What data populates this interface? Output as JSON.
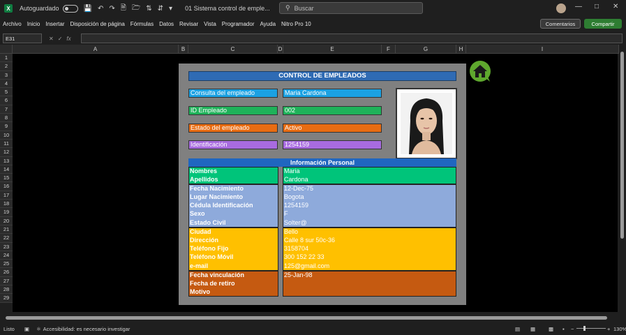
{
  "titlebar": {
    "autosave_label": "Autoguardado",
    "doc_title": "01 Sistema control de emple...",
    "search_placeholder": "Buscar"
  },
  "menu": [
    "Archivo",
    "Inicio",
    "Insertar",
    "Disposición de página",
    "Fórmulas",
    "Datos",
    "Revisar",
    "Vista",
    "Programador",
    "Ayuda",
    "Nitro Pro 10"
  ],
  "buttons": {
    "comments": "Comentarios",
    "share": "Compartir"
  },
  "formula": {
    "cell_ref": "E31",
    "fx": "fx"
  },
  "columns": [
    "A",
    "B",
    "C",
    "D",
    "E",
    "F",
    "G",
    "H",
    "I"
  ],
  "rows": [
    "1",
    "2",
    "3",
    "4",
    "5",
    "6",
    "7",
    "8",
    "9",
    "10",
    "11",
    "12",
    "13",
    "14",
    "15",
    "16",
    "17",
    "18",
    "19",
    "20",
    "21",
    "22",
    "23",
    "24",
    "25",
    "26",
    "27",
    "28",
    "29"
  ],
  "form": {
    "title": "CONTROL DE EMPLEADOS",
    "consulta_label": "Consulta del empleado",
    "consulta_value": "Maria Cardona",
    "id_label": "ID Empleado",
    "id_value": "002",
    "estado_label": "Estado del empleado",
    "estado_value": "Activo",
    "ident_label": "Identificación",
    "ident_value": "1254159"
  },
  "info": {
    "title": "Información Personal",
    "rows": [
      {
        "label": "Nombres",
        "value": "Maria"
      },
      {
        "label": "Apellidos",
        "value": "Cardona"
      },
      {
        "label": "Fecha Nacimiento",
        "value": "12-Dec-75"
      },
      {
        "label": "Lugar Nacimiento",
        "value": "Bogota"
      },
      {
        "label": "Cédula Identificación",
        "value": "1254159"
      },
      {
        "label": "Sexo",
        "value": "F"
      },
      {
        "label": "Estado Civil",
        "value": "Solter@"
      },
      {
        "label": "Ciudad",
        "value": "Bello"
      },
      {
        "label": "Dirección",
        "value": "Calle 8 sur 50c-36"
      },
      {
        "label": "Teléfono Fijo",
        "value": "3158704"
      },
      {
        "label": "Teléfono Móvil",
        "value": "300 152 22 33"
      },
      {
        "label": "e-mail",
        "value": "125@gmail.com"
      },
      {
        "label": "Fecha vinculación",
        "value": "25-Jan-98"
      },
      {
        "label": "Fecha de retiro",
        "value": ""
      },
      {
        "label": "Motivo",
        "value": ""
      }
    ]
  },
  "status": {
    "ready": "Listo",
    "accessibility": "Accesibilidad: es necesario investigar",
    "zoom": "130%"
  },
  "colors": {
    "title_bar": "#2f6bb4",
    "consulta": "#1ba1e2",
    "id": "#1fb25a",
    "estado": "#e86c12",
    "ident": "#a86be0",
    "green_block": "#00c47a",
    "blue_block": "#8eaadb",
    "yellow_block": "#ffc000",
    "orange_block": "#c55a11"
  }
}
